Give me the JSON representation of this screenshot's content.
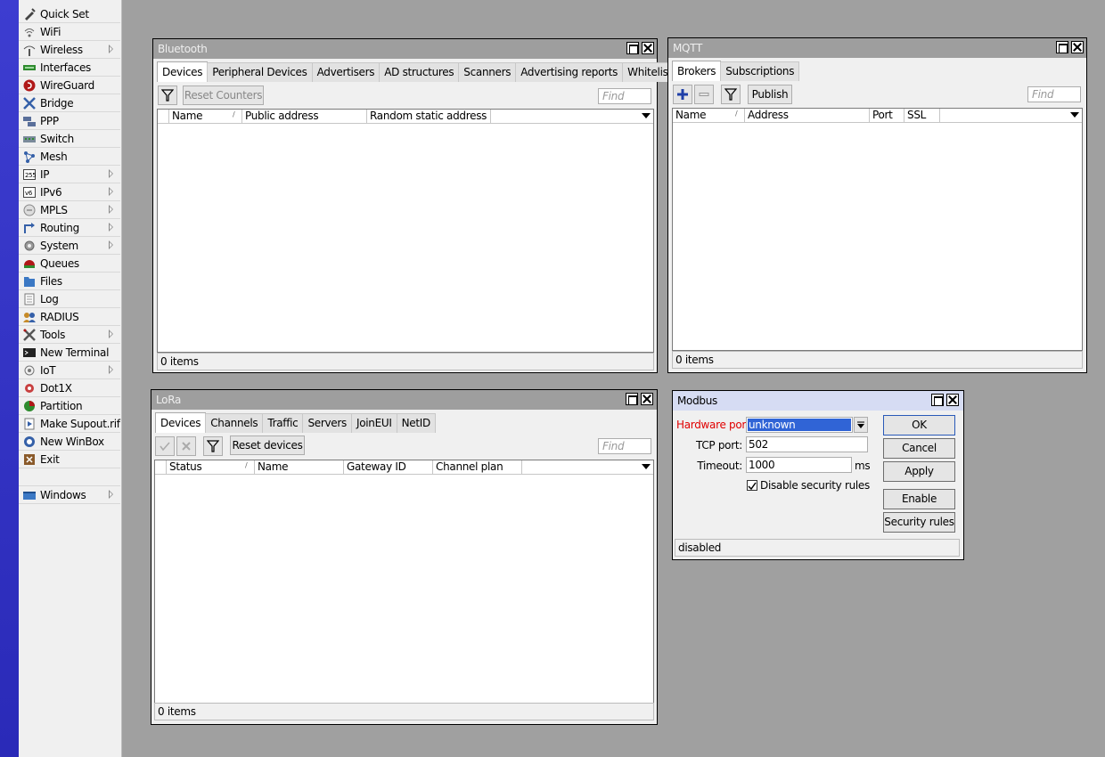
{
  "menu": {
    "items": [
      {
        "label": "Quick Set",
        "icon": "quick-set-icon",
        "submenu": false
      },
      {
        "label": "WiFi",
        "icon": "wifi-icon",
        "submenu": false
      },
      {
        "label": "Wireless",
        "icon": "wireless-icon",
        "submenu": true
      },
      {
        "label": "Interfaces",
        "icon": "interfaces-icon",
        "submenu": false
      },
      {
        "label": "WireGuard",
        "icon": "wireguard-icon",
        "submenu": false
      },
      {
        "label": "Bridge",
        "icon": "bridge-icon",
        "submenu": false
      },
      {
        "label": "PPP",
        "icon": "ppp-icon",
        "submenu": false
      },
      {
        "label": "Switch",
        "icon": "switch-icon",
        "submenu": false
      },
      {
        "label": "Mesh",
        "icon": "mesh-icon",
        "submenu": false
      },
      {
        "label": "IP",
        "icon": "ip-icon",
        "submenu": true
      },
      {
        "label": "IPv6",
        "icon": "ipv6-icon",
        "submenu": true
      },
      {
        "label": "MPLS",
        "icon": "mpls-icon",
        "submenu": true
      },
      {
        "label": "Routing",
        "icon": "routing-icon",
        "submenu": true
      },
      {
        "label": "System",
        "icon": "system-icon",
        "submenu": true
      },
      {
        "label": "Queues",
        "icon": "queues-icon",
        "submenu": false
      },
      {
        "label": "Files",
        "icon": "files-icon",
        "submenu": false
      },
      {
        "label": "Log",
        "icon": "log-icon",
        "submenu": false
      },
      {
        "label": "RADIUS",
        "icon": "radius-icon",
        "submenu": false
      },
      {
        "label": "Tools",
        "icon": "tools-icon",
        "submenu": true
      },
      {
        "label": "New Terminal",
        "icon": "terminal-icon",
        "submenu": false
      },
      {
        "label": "IoT",
        "icon": "iot-icon",
        "submenu": true
      },
      {
        "label": "Dot1X",
        "icon": "dot1x-icon",
        "submenu": false
      },
      {
        "label": "Partition",
        "icon": "partition-icon",
        "submenu": false
      },
      {
        "label": "Make Supout.rif",
        "icon": "supout-icon",
        "submenu": false
      },
      {
        "label": "New WinBox",
        "icon": "winbox-icon",
        "submenu": false
      },
      {
        "label": "Exit",
        "icon": "exit-icon",
        "submenu": false
      }
    ],
    "windows_label": "Windows"
  },
  "bluetooth": {
    "title": "Bluetooth",
    "tabs": [
      "Devices",
      "Peripheral Devices",
      "Advertisers",
      "AD structures",
      "Scanners",
      "Advertising reports",
      "Whitelist"
    ],
    "reset_label": "Reset Counters",
    "find_placeholder": "Find",
    "columns": [
      "Name",
      "Public address",
      "Random static address"
    ],
    "status": "0 items"
  },
  "mqtt": {
    "title": "MQTT",
    "tabs": [
      "Brokers",
      "Subscriptions"
    ],
    "publish_label": "Publish",
    "find_placeholder": "Find",
    "columns": [
      "Name",
      "Address",
      "Port",
      "SSL"
    ],
    "status": "0 items"
  },
  "lora": {
    "title": "LoRa",
    "tabs": [
      "Devices",
      "Channels",
      "Traffic",
      "Servers",
      "JoinEUI",
      "NetID"
    ],
    "reset_label": "Reset devices",
    "find_placeholder": "Find",
    "columns": [
      "Status",
      "Name",
      "Gateway ID",
      "Channel plan"
    ],
    "status": "0 items"
  },
  "modbus": {
    "title": "Modbus",
    "hw_port_label": "Hardware port:",
    "hw_port_value": "unknown",
    "tcp_port_label": "TCP port:",
    "tcp_port_value": "502",
    "timeout_label": "Timeout:",
    "timeout_value": "1000",
    "timeout_unit": "ms",
    "checkbox_label": "Disable security rules",
    "buttons": {
      "ok": "OK",
      "cancel": "Cancel",
      "apply": "Apply",
      "enable": "Enable",
      "security": "Security rules"
    },
    "status": "disabled",
    "colors": {
      "error_label": "#e00000",
      "selection": "#3064d6"
    }
  }
}
